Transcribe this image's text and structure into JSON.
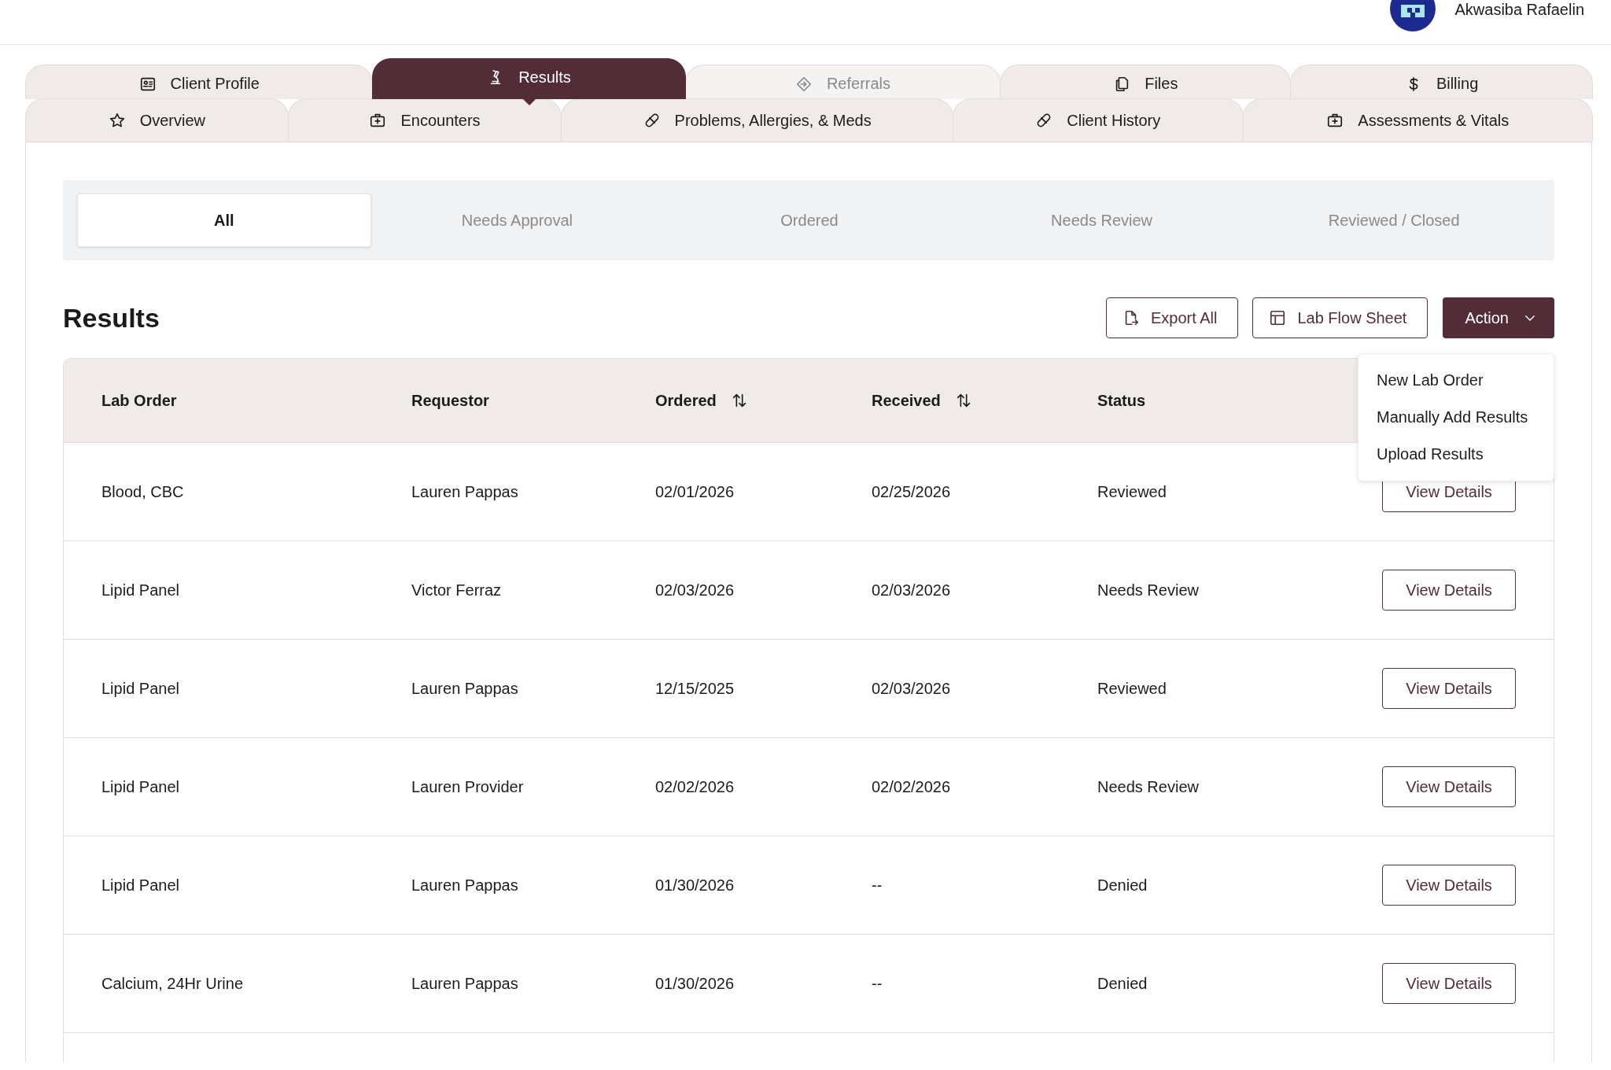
{
  "user": {
    "name": "Akwasiba Rafaelin"
  },
  "tab_rows": [
    {
      "tabs": [
        {
          "label": "Client Profile",
          "selected": false,
          "disabled": false
        },
        {
          "label": "Results",
          "selected": true,
          "disabled": false
        },
        {
          "label": "Referrals",
          "selected": false,
          "disabled": true
        },
        {
          "label": "Files",
          "selected": false,
          "disabled": false
        },
        {
          "label": "Billing",
          "selected": false,
          "disabled": false
        }
      ]
    },
    {
      "tabs": [
        {
          "label": "Overview",
          "selected": false,
          "disabled": false
        },
        {
          "label": "Encounters",
          "selected": false,
          "disabled": false
        },
        {
          "label": "Problems, Allergies, & Meds",
          "selected": false,
          "disabled": false
        },
        {
          "label": "Client History",
          "selected": false,
          "disabled": false
        },
        {
          "label": "Assessments & Vitals",
          "selected": false,
          "disabled": false
        }
      ]
    }
  ],
  "filters": [
    {
      "label": "All",
      "selected": true
    },
    {
      "label": "Needs Approval",
      "selected": false
    },
    {
      "label": "Ordered",
      "selected": false
    },
    {
      "label": "Needs Review",
      "selected": false
    },
    {
      "label": "Reviewed / Closed",
      "selected": false
    }
  ],
  "section_title": "Results",
  "toolbar": {
    "export_button": "Export All",
    "flow_sheet_button": "Lab Flow Sheet",
    "action_button": "Action"
  },
  "action_menu": {
    "open": true,
    "items": [
      "New Lab Order",
      "Manually Add Results",
      "Upload Results"
    ]
  },
  "table": {
    "columns": [
      {
        "label": "Lab Order",
        "sortable": false
      },
      {
        "label": "Requestor",
        "sortable": false
      },
      {
        "label": "Ordered",
        "sortable": true
      },
      {
        "label": "Received",
        "sortable": true
      },
      {
        "label": "Status",
        "sortable": false
      }
    ],
    "rows": [
      {
        "lab_order": "Blood, CBC",
        "requestor": "Lauren Pappas",
        "ordered": "02/01/2026",
        "received": "02/25/2026",
        "status": "Reviewed",
        "action": "View Details"
      },
      {
        "lab_order": "Lipid Panel",
        "requestor": "Victor Ferraz",
        "ordered": "02/03/2026",
        "received": "02/03/2026",
        "status": "Needs Review",
        "action": "View Details"
      },
      {
        "lab_order": "Lipid Panel",
        "requestor": "Lauren Pappas",
        "ordered": "12/15/2025",
        "received": "02/03/2026",
        "status": "Reviewed",
        "action": "View Details"
      },
      {
        "lab_order": "Lipid Panel",
        "requestor": "Lauren Provider",
        "ordered": "02/02/2026",
        "received": "02/02/2026",
        "status": "Needs Review",
        "action": "View Details"
      },
      {
        "lab_order": "Lipid Panel",
        "requestor": "Lauren Pappas",
        "ordered": "01/30/2026",
        "received": "--",
        "status": "Denied",
        "action": "View Details"
      },
      {
        "lab_order": "Calcium, 24Hr Urine",
        "requestor": "Lauren Pappas",
        "ordered": "01/30/2026",
        "received": "--",
        "status": "Denied",
        "action": "View Details"
      }
    ]
  }
}
